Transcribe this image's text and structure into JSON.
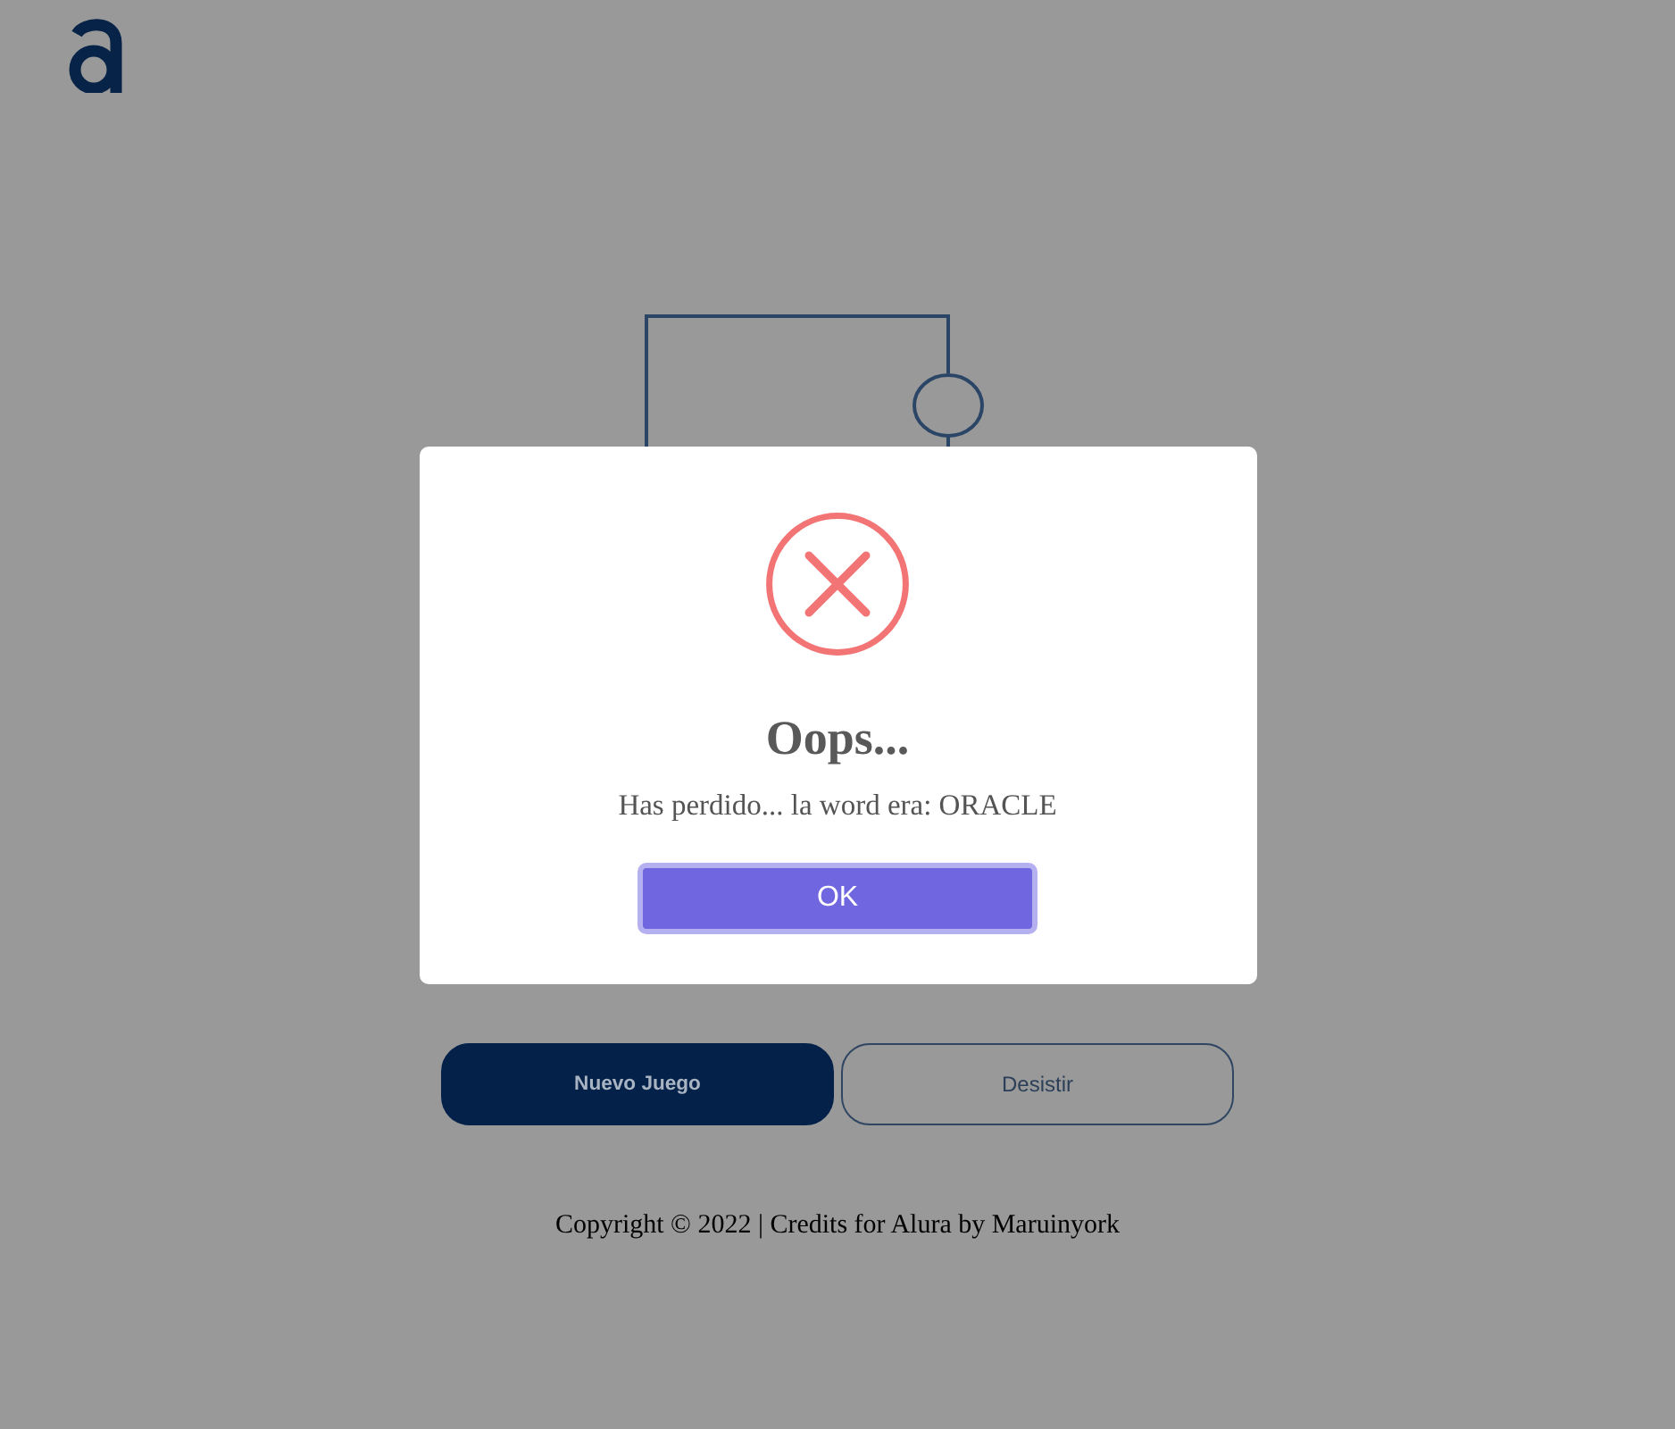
{
  "game_buttons": [
    {
      "label": "Nuevo Juego",
      "kind": "primary"
    },
    {
      "label": "Desistir",
      "kind": "outline"
    }
  ],
  "footer": {
    "text": "Copyright © 2022 | Credits for Alura by Maruinyork"
  },
  "dialog": {
    "kind": "error",
    "title": "Oops...",
    "message": "Has perdido... la word era: ORACLE",
    "confirm_button": "OK"
  }
}
